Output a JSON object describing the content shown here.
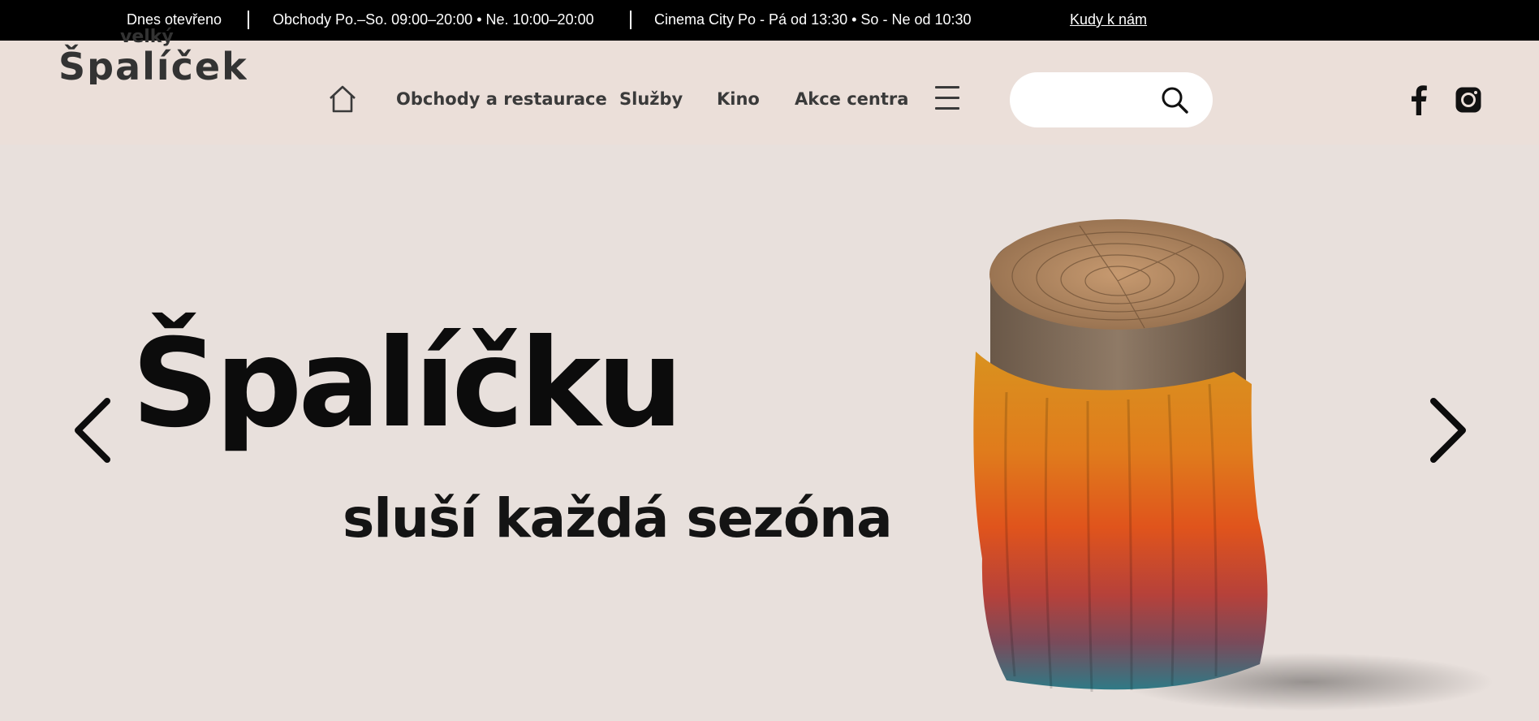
{
  "topbar": {
    "status": "Dnes otevřeno",
    "shops_hours": "Obchody Po.–So. 09:00–20:00 • Ne. 10:00–20:00",
    "cinema_hours": "Cinema City Po - Pá od 13:30 • So - Ne od 10:30",
    "directions_link": "Kudy k nám"
  },
  "logo": {
    "top_word": "velký",
    "main_word": "Špalíček"
  },
  "nav": {
    "home_icon": "home-icon",
    "items": [
      "Obchody a restaurace",
      "Služby",
      "Kino",
      "Akce centra"
    ],
    "menu_icon": "hamburger-menu-icon"
  },
  "search": {
    "value": "",
    "placeholder": "",
    "icon": "search-icon"
  },
  "social": {
    "facebook_icon": "facebook-icon",
    "instagram_icon": "instagram-icon"
  },
  "hero": {
    "title": "Špalíčku",
    "subtitle": "sluší každá sezóna",
    "prev_icon": "chevron-left-icon",
    "next_icon": "chevron-right-icon"
  },
  "colors": {
    "topbar_bg": "#000000",
    "header_bg": "#ebdfd9",
    "hero_bg": "#e8e0dc",
    "text_dark": "#0c0c0c"
  }
}
